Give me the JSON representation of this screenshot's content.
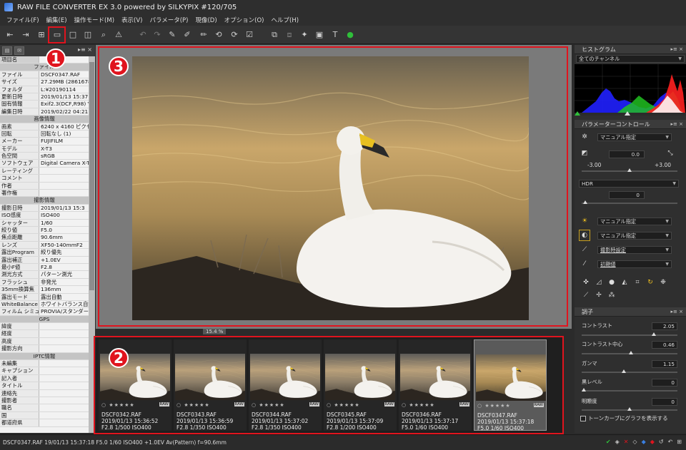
{
  "window": {
    "title": "RAW FILE CONVERTER EX 3.0 powered by SILKYPIX   #120/705"
  },
  "menu": [
    "ファイル(F)",
    "編集(E)",
    "操作モード(M)",
    "表示(V)",
    "パラメータ(P)",
    "現像(D)",
    "オプション(O)",
    "ヘルプ(H)"
  ],
  "callouts": [
    "1",
    "2",
    "3"
  ],
  "info_panel": {
    "column_header": "項目名",
    "rows": [
      {
        "section": "ファイル"
      },
      {
        "k": "ファイル",
        "v": "DSCF0347.RAF"
      },
      {
        "k": "サイズ",
        "v": "27.29MB (2861678"
      },
      {
        "k": "フォルダ",
        "v": "L:¥20190114"
      },
      {
        "k": "更新日時",
        "v": "2019/01/13 15:37:"
      },
      {
        "k": "固有情報",
        "v": "Exif2.3(DCF,R98) Y"
      },
      {
        "k": "編集日時",
        "v": "2019/02/22 04:21:"
      },
      {
        "section": "画像情報"
      },
      {
        "k": "画素",
        "v": "6240 x 4160 ピクセ"
      },
      {
        "k": "回転",
        "v": "回転なし (1)"
      },
      {
        "k": "メーカー",
        "v": "FUJIFILM"
      },
      {
        "k": "モデル",
        "v": "X-T3"
      },
      {
        "k": "色空間",
        "v": "sRGB"
      },
      {
        "k": "ソフトウェア",
        "v": "Digital Camera X-T"
      },
      {
        "k": "レーティング",
        "v": ""
      },
      {
        "k": "コメント",
        "v": ""
      },
      {
        "k": "作者",
        "v": ""
      },
      {
        "k": "著作権",
        "v": ""
      },
      {
        "section": "撮影情報"
      },
      {
        "k": "撮影日時",
        "v": "2019/01/13 15:3"
      },
      {
        "k": "ISO感度",
        "v": "ISO400"
      },
      {
        "k": "シャッター",
        "v": "1/60"
      },
      {
        "k": "絞り値",
        "v": "F5.0"
      },
      {
        "k": "焦点距離",
        "v": "90.6mm"
      },
      {
        "k": "レンズ",
        "v": "XF50-140mmF2"
      },
      {
        "k": "露出Program",
        "v": "絞り優先"
      },
      {
        "k": "露出補正",
        "v": "+1.0EV"
      },
      {
        "k": "最小F値",
        "v": "F2.8"
      },
      {
        "k": "測光方式",
        "v": "パターン測光"
      },
      {
        "k": "フラッシュ",
        "v": "非発光"
      },
      {
        "k": "35mm換算焦",
        "v": "136mm"
      },
      {
        "k": "露出モード",
        "v": "露出自動"
      },
      {
        "k": "WhiteBalance",
        "v": "ホワイトバランス自動"
      },
      {
        "k": "フィルム シミュレ",
        "v": "PROVIA/スタンダード"
      },
      {
        "section": "GPS"
      },
      {
        "k": "緯度",
        "v": ""
      },
      {
        "k": "経度",
        "v": ""
      },
      {
        "k": "高度",
        "v": ""
      },
      {
        "k": "撮影方向",
        "v": ""
      },
      {
        "section": "IPTC情報"
      },
      {
        "k": "未編集",
        "v": ""
      },
      {
        "k": "キャプション",
        "v": ""
      },
      {
        "k": "記入者",
        "v": ""
      },
      {
        "k": "タイトル",
        "v": ""
      },
      {
        "k": "連絡先",
        "v": ""
      },
      {
        "k": "撮影者",
        "v": ""
      },
      {
        "k": "職名",
        "v": ""
      },
      {
        "k": "国",
        "v": ""
      },
      {
        "k": "都道府県",
        "v": ""
      }
    ]
  },
  "preview": {
    "zoom": "15.4 %"
  },
  "filmstrip": [
    {
      "name": "DSCF0342.RAF",
      "date": "2019/01/13 15:36:52",
      "exif": "F2.8 1/500 ISO400",
      "selected": false
    },
    {
      "name": "DSCF0343.RAF",
      "date": "2019/01/13 15:36:59",
      "exif": "F2.8 1/350 ISO400",
      "selected": false
    },
    {
      "name": "DSCF0344.RAF",
      "date": "2019/01/13 15:37:02",
      "exif": "F2.8 1/350 ISO400",
      "selected": false
    },
    {
      "name": "DSCF0345.RAF",
      "date": "2019/01/13 15:37:09",
      "exif": "F2.8 1/200 ISO400",
      "selected": false
    },
    {
      "name": "DSCF0346.RAF",
      "date": "2019/01/13 15:37:17",
      "exif": "F5.0 1/60 ISO400",
      "selected": false
    },
    {
      "name": "DSCF0347.RAF",
      "date": "2019/01/13 15:37:18",
      "exif": "F5.0 1/60 ISO400",
      "selected": true
    }
  ],
  "film_rating": "○ ★★★★★",
  "film_raw_badge": "RAW",
  "right_panel": {
    "histogram": {
      "title": "ヒストグラム",
      "channel": "全てのチャンネル"
    },
    "param_control": {
      "title": "パラメーターコントロール",
      "taste": "マニュアル指定",
      "exposure_value": "0.0",
      "exposure_min": "-3.00",
      "exposure_max": "+3.00",
      "hdr_label": "HDR",
      "hdr_value": "0",
      "wb": "マニュアル指定",
      "tone": "マニュアル指定",
      "sharpness": "撮影時設定",
      "noise": "初期値"
    },
    "tone_panel": {
      "title": "調子",
      "params": [
        {
          "label": "コントラスト",
          "value": "2.05"
        },
        {
          "label": "コントラスト中心",
          "value": "0.46"
        },
        {
          "label": "ガンマ",
          "value": "1.15"
        },
        {
          "label": "黒レベル",
          "value": "0"
        },
        {
          "label": "明瞭度",
          "value": "0"
        }
      ],
      "checkbox_label": "トーンカーブにグラフを表示する"
    }
  },
  "status": {
    "text": "DSCF0347.RAF 19/01/13 15:37:18 F5.0 1/60 ISO400 +1.0EV Av(Pattern) f=90.6mm"
  },
  "colors": {
    "accent_red": "#e0141e",
    "ok_green": "#2fbf3a"
  },
  "icons": {
    "toolbar": [
      "open-icon",
      "save-icon",
      "grid-view-icon",
      "filmstrip-view-icon",
      "single-view-icon",
      "compare-view-icon",
      "zoom-icon",
      "warning-icon",
      "undo-icon",
      "redo-icon",
      "param-copy-icon",
      "param-paste-icon",
      "param-edit-icon",
      "rotate-left-icon",
      "rotate-right-icon",
      "check-icon",
      "develop-icon",
      "batch-icon",
      "print-icon",
      "fullscreen-icon",
      "text-icon",
      "ok-icon"
    ]
  }
}
